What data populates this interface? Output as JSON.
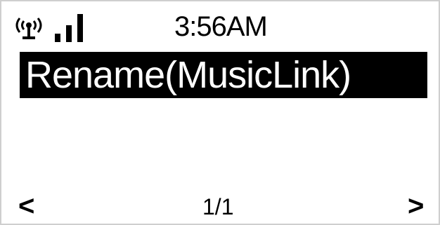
{
  "status_bar": {
    "wifi_icon": "wifi-icon",
    "signal_icon": "signal-strength-icon",
    "signal_level": 3,
    "time": "3:56AM"
  },
  "menu": {
    "items": [
      {
        "label": "Rename(MusicLink)",
        "selected": true
      }
    ]
  },
  "footer": {
    "prev_label": "<",
    "page_indicator": "1/1",
    "next_label": ">"
  },
  "colors": {
    "background": "#ffffff",
    "foreground": "#000000",
    "highlight_background": "#000000",
    "highlight_text": "#ffffff"
  }
}
